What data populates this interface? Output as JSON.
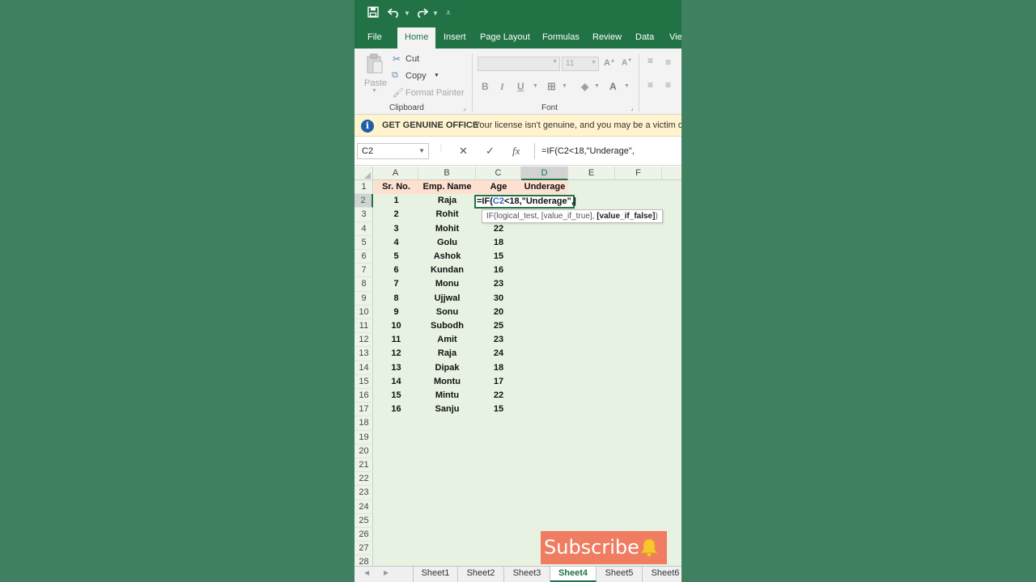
{
  "quick_access": {
    "save_icon": "save-icon",
    "undo_icon": "undo-icon",
    "redo_icon": "redo-icon",
    "customize_icon": "customize-qat-icon"
  },
  "ribbon_tabs": [
    "File",
    "Home",
    "Insert",
    "Page Layout",
    "Formulas",
    "Review",
    "Data",
    "Vie"
  ],
  "clipboard": {
    "paste": "Paste",
    "cut": "Cut",
    "copy": "Copy",
    "format_painter": "Format Painter",
    "label": "Clipboard"
  },
  "font": {
    "size": "11",
    "label": "Font"
  },
  "message_bar": {
    "title": "GET GENUINE OFFICE",
    "text": "Your license isn't genuine, and you may be a victim of"
  },
  "formula_bar": {
    "name_box": "C2",
    "formula": "=IF(C2<18,\"Underage\","
  },
  "columns": [
    "A",
    "B",
    "C",
    "D",
    "E",
    "F"
  ],
  "rows": [
    "1",
    "2",
    "3",
    "4",
    "5",
    "6",
    "7",
    "8",
    "9",
    "10",
    "11",
    "12",
    "13",
    "14",
    "15",
    "16",
    "17",
    "18",
    "19",
    "20",
    "21",
    "22",
    "23",
    "24",
    "25",
    "26",
    "27",
    "28"
  ],
  "table": {
    "headers": [
      "Sr. No.",
      "Emp. Name",
      "Age",
      "Underage"
    ],
    "data": [
      [
        "1",
        "Raja",
        ""
      ],
      [
        "2",
        "Rohit",
        ""
      ],
      [
        "3",
        "Mohit",
        "22"
      ],
      [
        "4",
        "Golu",
        "18"
      ],
      [
        "5",
        "Ashok",
        "15"
      ],
      [
        "6",
        "Kundan",
        "16"
      ],
      [
        "7",
        "Monu",
        "23"
      ],
      [
        "8",
        "Ujjwal",
        "30"
      ],
      [
        "9",
        "Sonu",
        "20"
      ],
      [
        "10",
        "Subodh",
        "25"
      ],
      [
        "11",
        "Amit",
        "23"
      ],
      [
        "12",
        "Raja",
        "24"
      ],
      [
        "13",
        "Dipak",
        "18"
      ],
      [
        "14",
        "Montu",
        "17"
      ],
      [
        "15",
        "Mintu",
        "22"
      ],
      [
        "16",
        "Sanju",
        "15"
      ]
    ]
  },
  "edit_cell": {
    "prefix": "=IF(",
    "ref": "C2",
    "suffix": "<18,\"Underage\","
  },
  "tooltip": {
    "plain": "IF(logical_test, [value_if_true], ",
    "bold": "[value_if_false]",
    "close": ")"
  },
  "sheet_tabs": [
    "Sheet1",
    "Sheet2",
    "Sheet3",
    "Sheet4",
    "Sheet5",
    "Sheet6"
  ],
  "active_sheet": "Sheet4",
  "overlay": {
    "subscribe": "Subscribe",
    "icon": "bell-icon"
  },
  "colors": {
    "excel_green": "#217346",
    "background": "#3f8060",
    "header_fill": "#fde0d0",
    "grid_fill": "#e8f2e2",
    "message_bar": "#fff4ce",
    "subscribe": "#f07c62"
  }
}
